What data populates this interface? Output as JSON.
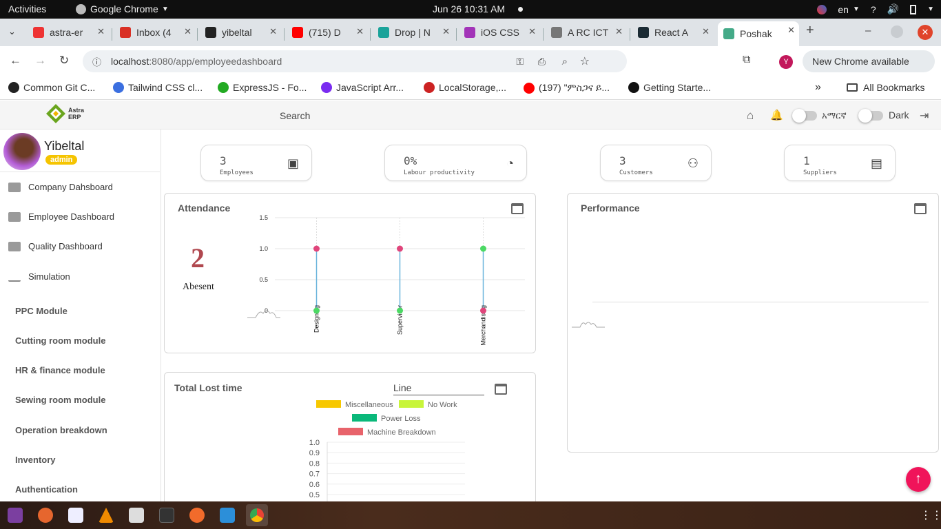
{
  "os": {
    "activities": "Activities",
    "app_name": "Google Chrome",
    "clock": "Jun 26  10:31 AM",
    "lang": "en"
  },
  "tabs": [
    {
      "title": "astra-er",
      "color": "#e33"
    },
    {
      "title": "Inbox (4",
      "color": "#d93025"
    },
    {
      "title": "yibeltal",
      "color": "#222"
    },
    {
      "title": "(715) D",
      "color": "#f00"
    },
    {
      "title": "Drop | N",
      "color": "#1aa39a"
    },
    {
      "title": "iOS CSS",
      "color": "#a234b8"
    },
    {
      "title": "A RC ICT",
      "color": "#777"
    },
    {
      "title": "React A",
      "color": "#1b2b34"
    },
    {
      "title": "Poshak",
      "color": "#4a8"
    }
  ],
  "browser": {
    "url_host": "localhost",
    "url_path": ":8080/app/employeedashboard",
    "profile_initial": "Y",
    "update_label": "New Chrome available"
  },
  "bookmarks": [
    {
      "label": "Common Git C...",
      "color": "#222"
    },
    {
      "label": "Tailwind CSS cl...",
      "color": "#3b6fe0"
    },
    {
      "label": "ExpressJS - Fo...",
      "color": "#2a2"
    },
    {
      "label": "JavaScript Arr...",
      "color": "#7a2cf0"
    },
    {
      "label": "LocalStorage,...",
      "color": "#c22"
    },
    {
      "label": "(197) \"ምስጋና ይ...",
      "color": "#f00"
    },
    {
      "label": "Getting Starte...",
      "color": "#111"
    }
  ],
  "all_bookmarks": "All Bookmarks",
  "header": {
    "logo_line1": "Astra",
    "logo_line2": "ERP",
    "search": "Search",
    "lang_toggle": "አማርኛ",
    "theme_toggle": "Dark"
  },
  "user": {
    "name": "Yibeltal",
    "role": "admin"
  },
  "nav": [
    "Company Dahsboard",
    "Employee Dashboard",
    "Quality Dashboard",
    "Simulation"
  ],
  "modules": [
    "PPC Module",
    "Cutting room module",
    "HR & finance module",
    "Sewing room module",
    "Operation breakdown",
    "Inventory",
    "Authentication"
  ],
  "stats": [
    {
      "value": "3",
      "label": "Employees",
      "icon": "id-badge-icon"
    },
    {
      "value": "0%",
      "label": "Labour productivity",
      "icon": "speedometer-icon"
    },
    {
      "value": "3",
      "label": "Customers",
      "icon": "users-icon"
    },
    {
      "value": "1",
      "label": "Suppliers",
      "icon": "contact-book-icon"
    }
  ],
  "attendance": {
    "title": "Attendance",
    "absent_count": "2",
    "absent_label": "Abesent"
  },
  "performance": {
    "title": "Performance"
  },
  "lost_time": {
    "title": "Total Lost time",
    "select_value": "Line"
  },
  "chart_data": [
    {
      "type": "line",
      "title": "Attendance",
      "categories": [
        "Designing",
        "Supervisor",
        "Merchandising"
      ],
      "ylim": [
        0,
        1.5
      ],
      "yticks": [
        "1.5",
        "1.0",
        "0.5",
        "0"
      ],
      "series": [
        {
          "color": "#e0457b",
          "values": [
            1,
            1,
            0
          ]
        },
        {
          "color": "#4cd964",
          "values": [
            0,
            0,
            1
          ]
        }
      ]
    },
    {
      "type": "bar",
      "title": "Total Lost time",
      "ylim": [
        0.5,
        1.0
      ],
      "yticks": [
        "1.0",
        "0.9",
        "0.8",
        "0.7",
        "0.6",
        "0.5"
      ],
      "legend": [
        {
          "name": "Miscellaneous",
          "color": "#f7c800"
        },
        {
          "name": "No Work",
          "color": "#c8f53a"
        },
        {
          "name": "Power Loss",
          "color": "#0ab87a"
        },
        {
          "name": "Machine Breakdown",
          "color": "#e8636b"
        }
      ]
    }
  ]
}
